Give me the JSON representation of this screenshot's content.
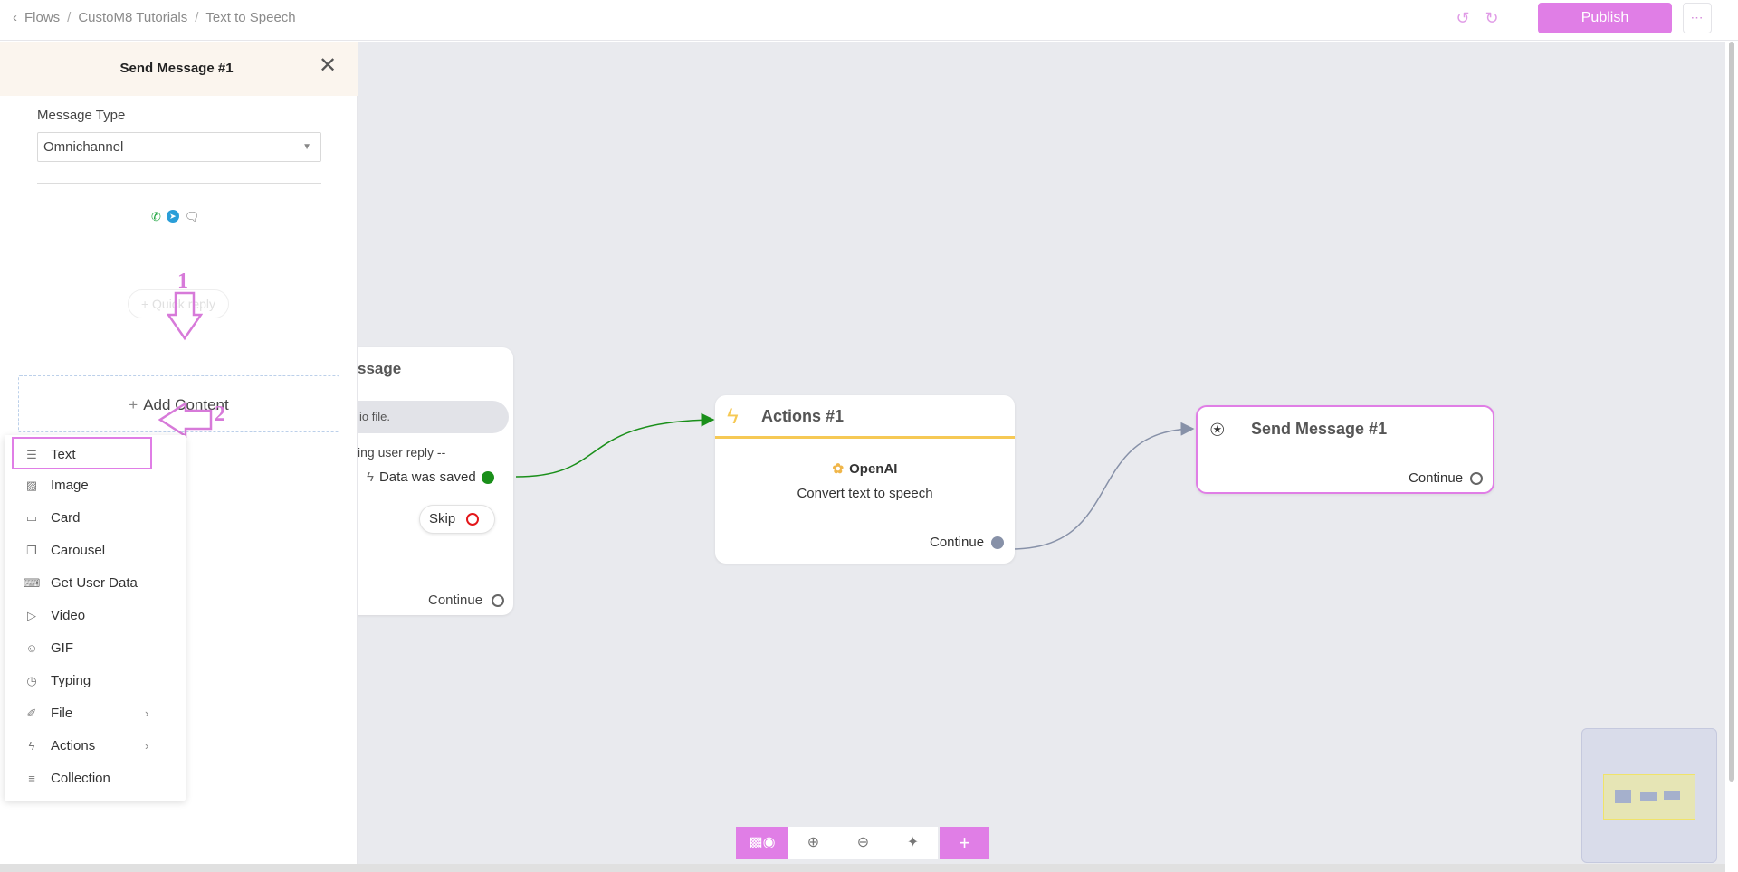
{
  "breadcrumb": {
    "back": "Flows",
    "sep": "/",
    "middle": "CustoM8 Tutorials",
    "current": "Text to Speech"
  },
  "topbar": {
    "publish_label": "Publish",
    "more_label": "⋯",
    "undo_icon": "undo-icon",
    "redo_icon": "redo-icon"
  },
  "panel": {
    "title": "Send Message #1",
    "message_type_label": "Message Type",
    "message_type_value": "Omnichannel",
    "channels": [
      "whatsapp-icon",
      "telegram-icon",
      "messenger-icon"
    ],
    "quick_reply_label": "+ Quick reply",
    "add_content_label": "Add Content"
  },
  "annotations": {
    "step1": "1",
    "step2": "2"
  },
  "menu": {
    "items": [
      {
        "label": "Text",
        "icon": "text-lines-icon",
        "glyph": "☰",
        "has_submenu": false,
        "selected": true
      },
      {
        "label": "Image",
        "icon": "image-icon",
        "glyph": "▨",
        "has_submenu": false,
        "selected": false
      },
      {
        "label": "Card",
        "icon": "card-icon",
        "glyph": "▭",
        "has_submenu": false,
        "selected": false
      },
      {
        "label": "Carousel",
        "icon": "carousel-icon",
        "glyph": "❐",
        "has_submenu": false,
        "selected": false
      },
      {
        "label": "Get User Data",
        "icon": "keyboard-icon",
        "glyph": "⌨",
        "has_submenu": false,
        "selected": false
      },
      {
        "label": "Video",
        "icon": "video-icon",
        "glyph": "▷",
        "has_submenu": false,
        "selected": false
      },
      {
        "label": "GIF",
        "icon": "gif-icon",
        "glyph": "☺",
        "has_submenu": false,
        "selected": false
      },
      {
        "label": "Typing",
        "icon": "clock-icon",
        "glyph": "◷",
        "has_submenu": false,
        "selected": false
      },
      {
        "label": "File",
        "icon": "paperclip-icon",
        "glyph": "✐",
        "has_submenu": true,
        "selected": false
      },
      {
        "label": "Actions",
        "icon": "bolt-icon",
        "glyph": "ϟ",
        "has_submenu": true,
        "selected": false
      },
      {
        "label": "Collection",
        "icon": "list-icon",
        "glyph": "≡",
        "has_submenu": false,
        "selected": false
      }
    ]
  },
  "nodes": {
    "node1": {
      "title_fragment": "ssage",
      "bubble_text": "io file.",
      "reply_text": "ing user reply --",
      "saved_label": "Data was saved",
      "skip_label": "Skip",
      "continue_label": "Continue"
    },
    "node2": {
      "title": "Actions #1",
      "service": "OpenAI",
      "description": "Convert text to speech",
      "continue_label": "Continue"
    },
    "node3": {
      "title": "Send Message #1",
      "continue_label": "Continue"
    }
  },
  "toolbar": {
    "buttons": [
      "eye-toggle",
      "zoom-in",
      "zoom-out",
      "auto-layout",
      "add-node"
    ],
    "plus_label": "+"
  },
  "colors": {
    "accent": "#e07ee6",
    "canvas_bg": "#e9eaee",
    "panel_header_bg": "#fbf5ee",
    "edge_green": "#1a8f1a",
    "edge_grey": "#8791a8",
    "action_yellow": "#f6c955"
  }
}
